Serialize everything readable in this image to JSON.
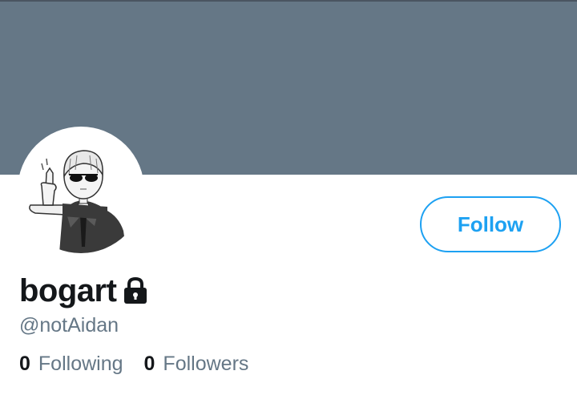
{
  "colors": {
    "banner": "#657786",
    "accent": "#1da1f2",
    "text_primary": "#14171a",
    "text_secondary": "#657786"
  },
  "profile": {
    "display_name": "bogart",
    "protected_icon": "lock-icon",
    "handle": "@notAidan",
    "avatar_icon": "avatar-illustration"
  },
  "actions": {
    "follow_label": "Follow"
  },
  "stats": {
    "following_count": "0",
    "following_label": "Following",
    "followers_count": "0",
    "followers_label": "Followers"
  }
}
